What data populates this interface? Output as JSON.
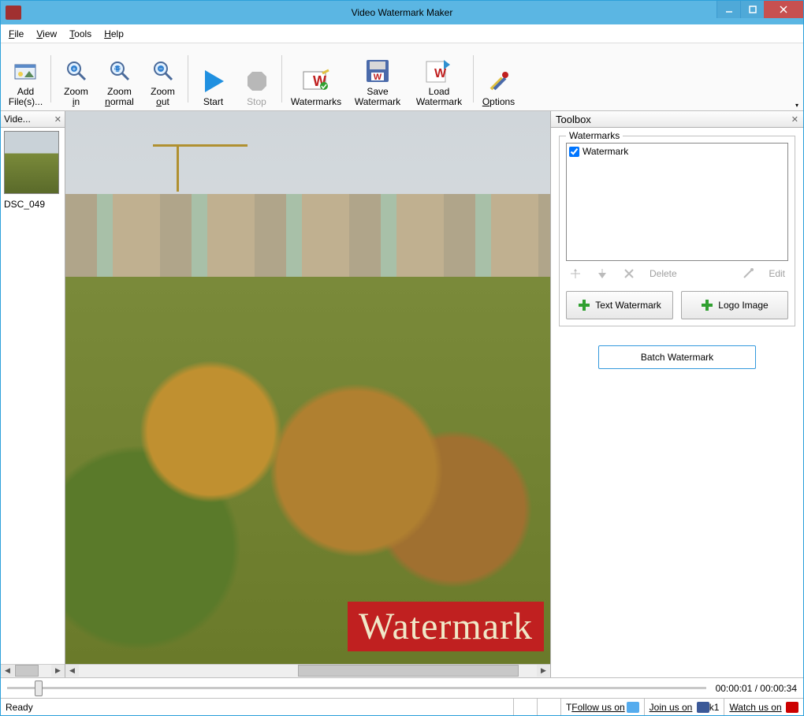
{
  "window": {
    "title": "Video Watermark Maker"
  },
  "menu": {
    "file": "File",
    "view": "View",
    "tools": "Tools",
    "help": "Help"
  },
  "toolbar": {
    "add_files": "Add File(s)...",
    "zoom_in": "Zoom in",
    "zoom_normal": "Zoom normal",
    "zoom_out": "Zoom out",
    "start": "Start",
    "stop": "Stop",
    "watermarks": "Watermarks",
    "save_watermark": "Save Watermark",
    "load_watermark": "Load Watermark",
    "options": "Options"
  },
  "sidebar": {
    "tab": "Vide...",
    "thumb_label": "DSC_049"
  },
  "preview": {
    "watermark_text": "Watermark"
  },
  "toolbox": {
    "title": "Toolbox",
    "group": "Watermarks",
    "items": [
      {
        "checked": true,
        "label": "Watermark"
      }
    ],
    "delete": "Delete",
    "edit": "Edit",
    "text_watermark": "Text Watermark",
    "logo_image": "Logo Image",
    "batch": "Batch Watermark"
  },
  "timeline": {
    "time": "00:00:01 / 00:00:34"
  },
  "status": {
    "ready": "Ready",
    "follow": "Follow us on",
    "join": "Join us on",
    "watch": "Watch us on"
  }
}
